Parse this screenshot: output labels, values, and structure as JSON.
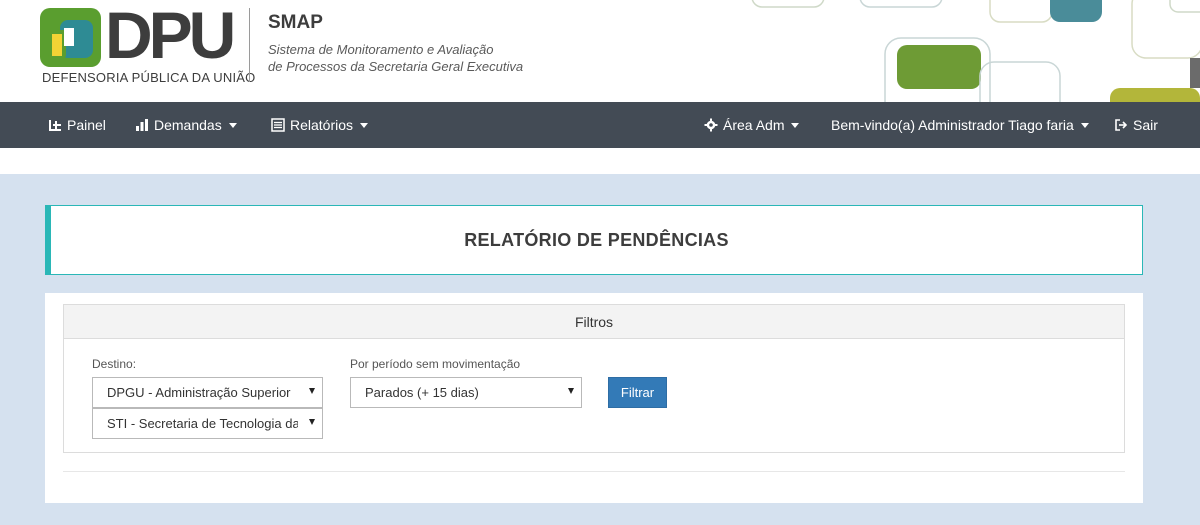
{
  "brand": {
    "logo_text": "DPU",
    "logo_subtitle": "DEFENSORIA PÚBLICA DA UNIÃO",
    "system_name": "SMAP",
    "system_desc_line1": "Sistema de Monitoramento e Avaliação",
    "system_desc_line2": "de Processos da Secretaria Geral Executiva"
  },
  "nav": {
    "painel": "Painel",
    "demandas": "Demandas",
    "relatorios": "Relatórios",
    "area_adm": "Área Adm",
    "welcome": "Bem-vindo(a) Administrador Tiago faria",
    "sair": "Sair"
  },
  "page": {
    "title": "RELATÓRIO DE PENDÊNCIAS"
  },
  "filters": {
    "heading": "Filtros",
    "destino_label": "Destino:",
    "destino_value": "DPGU - Administração Superior",
    "destino_sub_value": "STI - Secretaria de Tecnologia da",
    "periodo_label": "Por período sem movimentação",
    "periodo_value": "Parados (+ 15 dias)",
    "filter_button": "Filtrar"
  },
  "colors": {
    "navbar": "#434b55",
    "page_bg": "#d5e1ef",
    "accent_teal": "#2ab7b7",
    "button_blue": "#337ab7",
    "logo_green": "#5a9e2f",
    "logo_teal": "#2e8b94"
  }
}
